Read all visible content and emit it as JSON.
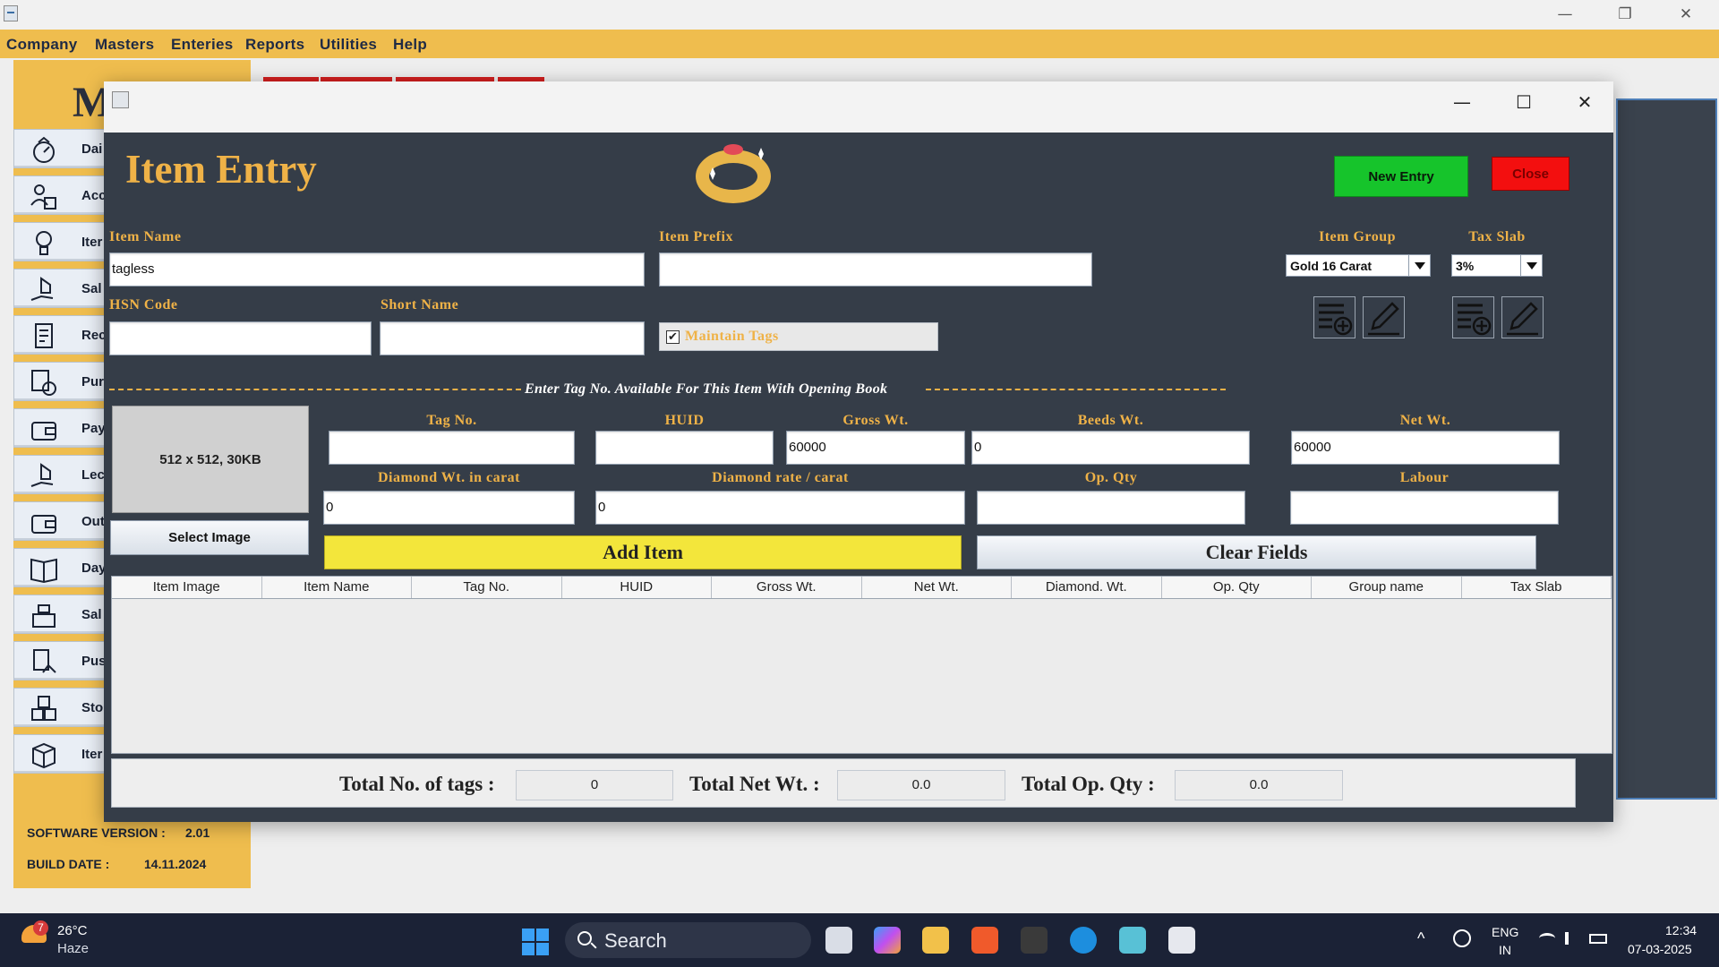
{
  "main_window": {
    "controls": {
      "minimize": "—",
      "restore": "❐",
      "close": "✕"
    }
  },
  "menu": [
    "Company",
    "Masters",
    "Enteries",
    "Reports",
    "Utilities",
    "Help"
  ],
  "sidebar": {
    "logo_letter": "M",
    "items": [
      {
        "label": "Dai",
        "icon": "dashboard-icon"
      },
      {
        "label": "Acc",
        "icon": "accounts-icon"
      },
      {
        "label": "Iter",
        "icon": "lightbulb-icon"
      },
      {
        "label": "Sal",
        "icon": "hand-house-icon"
      },
      {
        "label": "Rec",
        "icon": "receipt-icon"
      },
      {
        "label": "Pur",
        "icon": "purchase-icon"
      },
      {
        "label": "Pay",
        "icon": "wallet-icon"
      },
      {
        "label": "Lec",
        "icon": "ledger-icon"
      },
      {
        "label": "Out",
        "icon": "wallet-out-icon"
      },
      {
        "label": "Day",
        "icon": "daybook-icon"
      },
      {
        "label": "Sal",
        "icon": "sales-register-icon"
      },
      {
        "label": "Pus",
        "icon": "report-icon"
      },
      {
        "label": "Sto",
        "icon": "stock-boxes-icon"
      },
      {
        "label": "Iter",
        "icon": "item-box-icon"
      }
    ],
    "version_label": "SOFTWARE VERSION :",
    "version_value": "2.01",
    "build_label": "BUILD DATE :",
    "build_value": "14.11.2024"
  },
  "dialog": {
    "controls": {
      "minimize": "—",
      "maximize": "☐",
      "close": "✕"
    },
    "title": "Item Entry",
    "new_entry": "New Entry",
    "close": "Close",
    "labels": {
      "item_name": "Item Name",
      "item_prefix": "Item Prefix",
      "hsn_code": "HSN Code",
      "short_name": "Short Name",
      "item_group": "Item Group",
      "tax_slab": "Tax Slab",
      "maintain_tags": "Maintain Tags",
      "tag_no": "Tag No.",
      "huid": "HUID",
      "gross_wt": "Gross Wt.",
      "beeds_wt": "Beeds Wt.",
      "net_wt": "Net Wt.",
      "diamond_wt": "Diamond Wt. in carat",
      "diamond_rate": "Diamond rate / carat",
      "op_qty": "Op. Qty",
      "labour": "Labour"
    },
    "values": {
      "item_name": "tagless",
      "item_prefix": "",
      "hsn_code": "",
      "short_name": "",
      "item_group": "Gold 16 Carat",
      "tax_slab": "3%",
      "maintain_tags_checked": true,
      "check_mark": "✔",
      "tag_no": "",
      "huid": "",
      "gross_wt": "60000",
      "beeds_wt": "0",
      "net_wt": "60000",
      "diamond_wt": "0",
      "diamond_rate": "0",
      "op_qty": "",
      "labour": ""
    },
    "divider_text": "Enter Tag No. Available For This Item With Opening Book",
    "image_placeholder": "512 x 512, 30KB",
    "select_image": "Select Image",
    "add_item": "Add Item",
    "clear_fields": "Clear Fields",
    "table_headers": [
      "Item Image",
      "Item Name",
      "Tag No.",
      "HUID",
      "Gross Wt.",
      "Net Wt.",
      "Diamond. Wt.",
      "Op. Qty",
      "Group name",
      "Tax Slab"
    ],
    "table_rows": [],
    "totals": {
      "tags_label": "Total No. of tags :",
      "tags_value": "0",
      "net_label": "Total Net Wt. :",
      "net_value": "0.0",
      "opqty_label": "Total Op. Qty :",
      "opqty_value": "0.0"
    }
  },
  "taskbar": {
    "weather_badge": "7",
    "weather_temp": "26°C",
    "weather_desc": "Haze",
    "search_placeholder": "Search",
    "tray_chevron": "^",
    "language": "ENG",
    "region": "IN",
    "time": "12:34",
    "date": "07-03-2025"
  },
  "colors": {
    "accent_gold": "#efbd4e",
    "label_gold": "#efb247",
    "panel_dark": "#353d48",
    "new_entry_green": "#16c42b",
    "close_red": "#f30f0f",
    "add_item_yellow": "#f3e63b"
  }
}
